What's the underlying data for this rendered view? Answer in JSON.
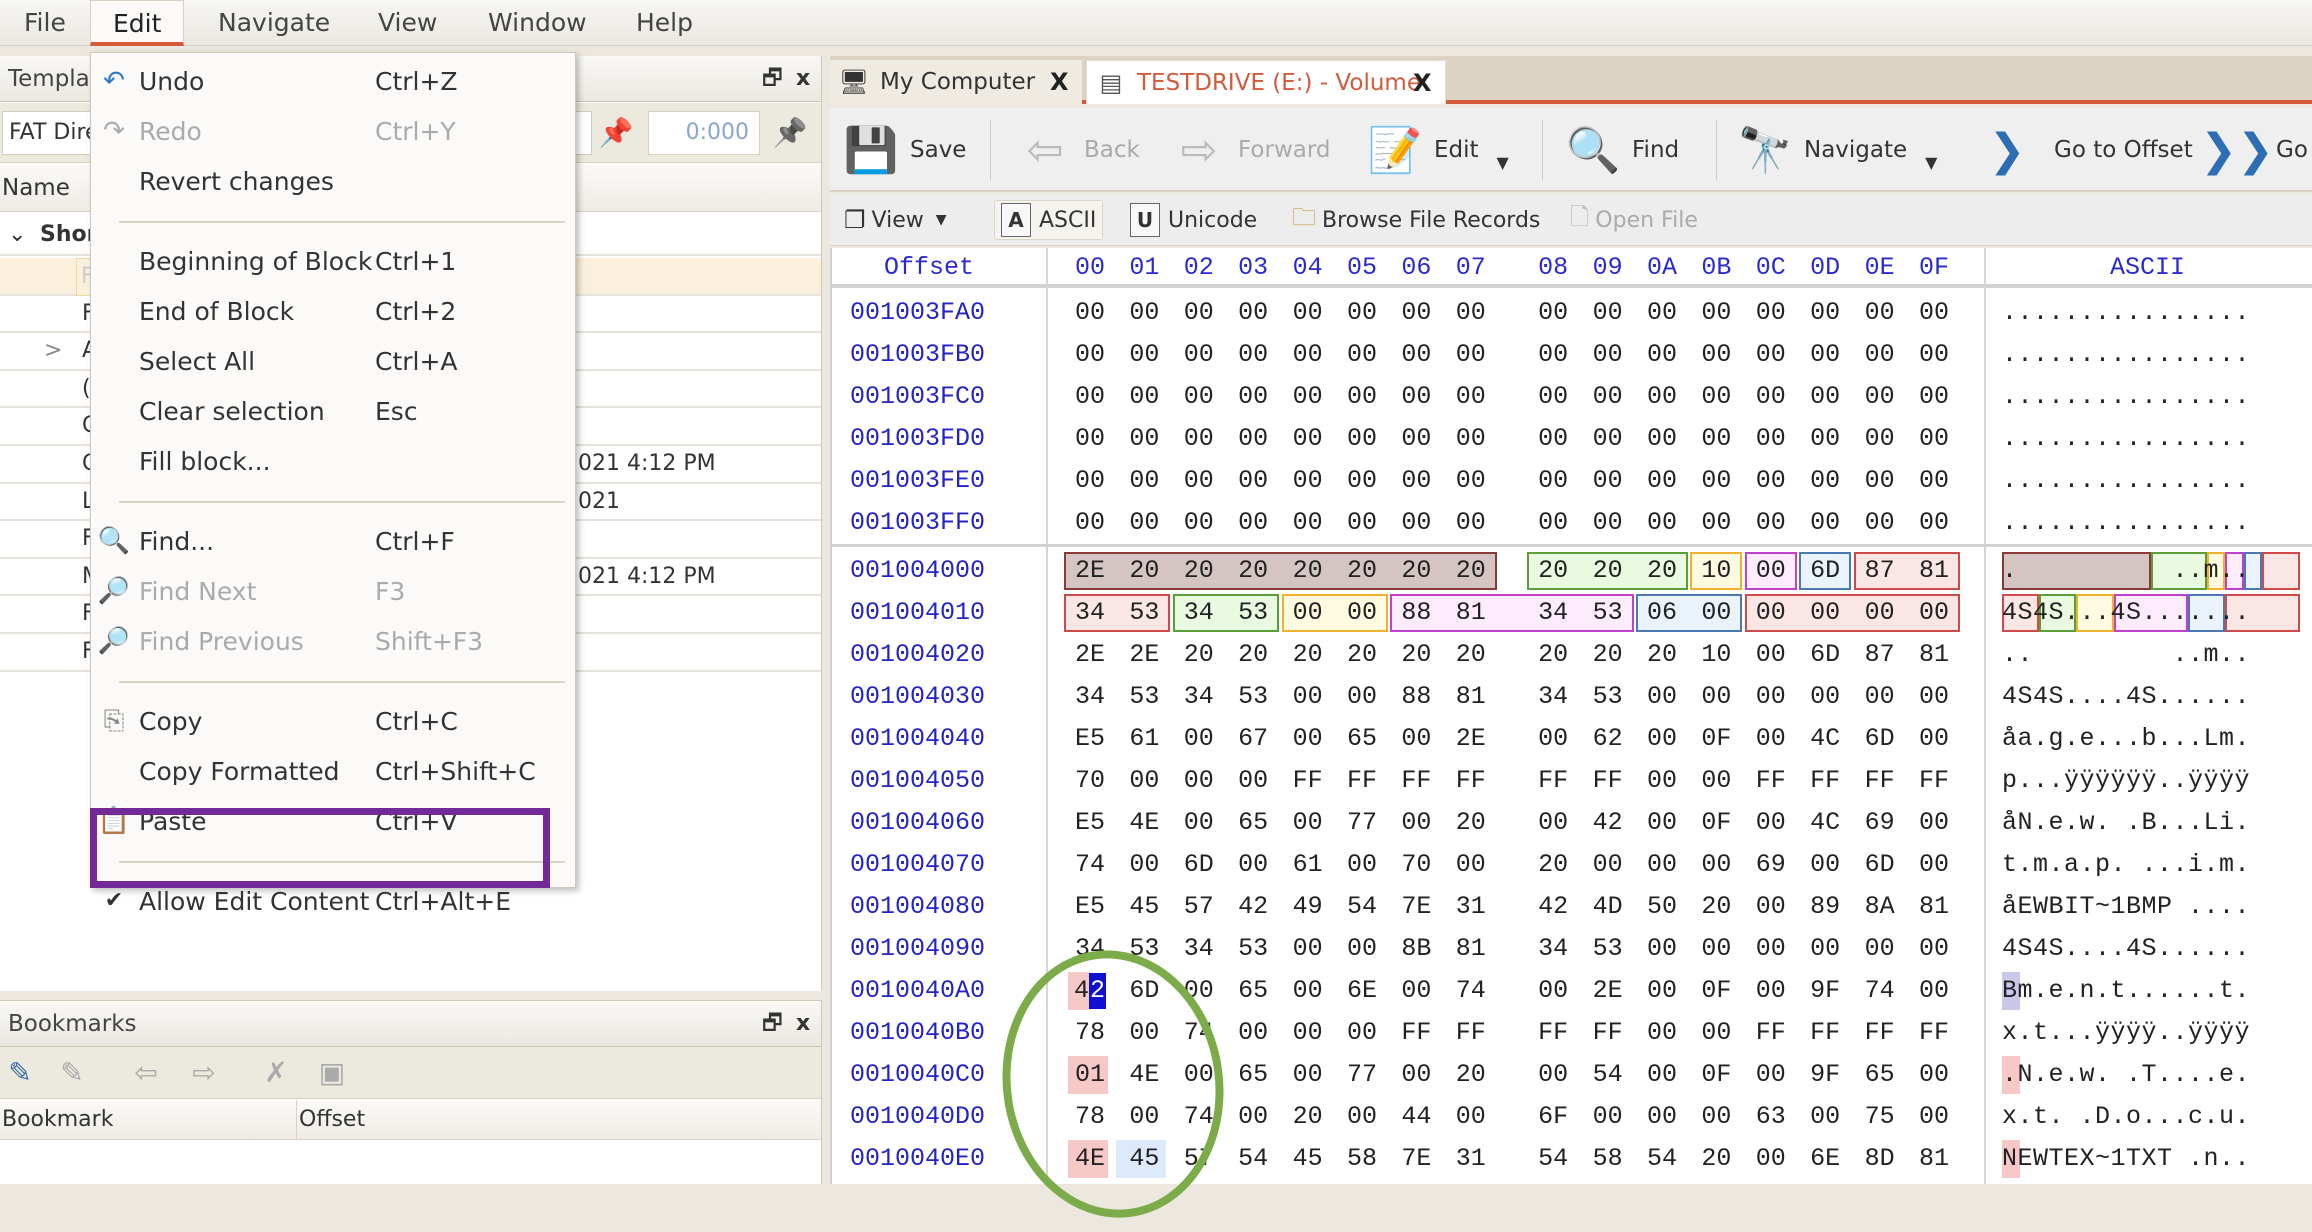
{
  "menubar": {
    "items": [
      "File",
      "Edit",
      "Navigate",
      "View",
      "Window",
      "Help"
    ],
    "active": "Edit"
  },
  "template_panel": {
    "title": "Templat",
    "template_select": "FAT Dire",
    "offset_value": "0:000",
    "column_name": "Name",
    "root_row": "Shor",
    "rows": [
      {
        "lead": "F",
        "tail": "",
        "selected": true
      },
      {
        "lead": "F",
        "tail": ""
      },
      {
        "lead": "A",
        "tail": "",
        "expander": ">"
      },
      {
        "lead": "(",
        "tail": ""
      },
      {
        "lead": "C",
        "tail": ""
      },
      {
        "lead": "C",
        "tail": "021 4:12 PM"
      },
      {
        "lead": "L",
        "tail": "021"
      },
      {
        "lead": "F",
        "tail": ""
      },
      {
        "lead": "M",
        "tail": "021 4:12 PM"
      },
      {
        "lead": "F",
        "tail": ""
      },
      {
        "lead": "F",
        "tail": ""
      }
    ]
  },
  "bookmarks_panel": {
    "title": "Bookmarks",
    "columns": [
      "Bookmark",
      "Offset"
    ]
  },
  "tabs": [
    {
      "label": "My Computer",
      "icon": "computer-icon",
      "active": false,
      "close": "X"
    },
    {
      "label": "TESTDRIVE (E:) - Volume",
      "icon": "volume-icon",
      "active": true,
      "close": "X"
    }
  ],
  "toolbar": {
    "save": "Save",
    "back": "Back",
    "forward": "Forward",
    "edit": "Edit",
    "find": "Find",
    "navigate": "Navigate",
    "go_to_offset": "Go to Offset",
    "go_partial": "Go"
  },
  "toolbar2": {
    "view": "View",
    "ascii": "ASCII",
    "unicode": "Unicode",
    "browse_file_records": "Browse File Records",
    "open_file": "Open File"
  },
  "hex": {
    "header_offset": "Offset",
    "header_cols": [
      "00",
      "01",
      "02",
      "03",
      "04",
      "05",
      "06",
      "07",
      "08",
      "09",
      "0A",
      "0B",
      "0C",
      "0D",
      "0E",
      "0F"
    ],
    "header_ascii": "ASCII",
    "colors": {
      "red_border": "#d04a4a",
      "red_fill": "#fbe6e6",
      "brown_border": "#8b3a3a",
      "brown_fill": "#d5c5c2",
      "green_border": "#5aa03a",
      "green_fill": "#eafae0",
      "yellow_border": "#f0b030",
      "yellow_fill": "#fffbe0",
      "magenta_border": "#c040d0",
      "magenta_fill": "#fcecfc",
      "blue_border": "#4a7ab0",
      "blue_fill": "#eaf2fb",
      "cursor": "#1010d0",
      "pink_mark": "#f6c8c6",
      "lightblue_mark": "#ddeafb"
    },
    "rows": [
      {
        "offset": "001003FA0",
        "bytes": [
          "00",
          "00",
          "00",
          "00",
          "00",
          "00",
          "00",
          "00",
          "00",
          "00",
          "00",
          "00",
          "00",
          "00",
          "00",
          "00"
        ],
        "ascii": "................"
      },
      {
        "offset": "001003FB0",
        "bytes": [
          "00",
          "00",
          "00",
          "00",
          "00",
          "00",
          "00",
          "00",
          "00",
          "00",
          "00",
          "00",
          "00",
          "00",
          "00",
          "00"
        ],
        "ascii": "................"
      },
      {
        "offset": "001003FC0",
        "bytes": [
          "00",
          "00",
          "00",
          "00",
          "00",
          "00",
          "00",
          "00",
          "00",
          "00",
          "00",
          "00",
          "00",
          "00",
          "00",
          "00"
        ],
        "ascii": "................"
      },
      {
        "offset": "001003FD0",
        "bytes": [
          "00",
          "00",
          "00",
          "00",
          "00",
          "00",
          "00",
          "00",
          "00",
          "00",
          "00",
          "00",
          "00",
          "00",
          "00",
          "00"
        ],
        "ascii": "................"
      },
      {
        "offset": "001003FE0",
        "bytes": [
          "00",
          "00",
          "00",
          "00",
          "00",
          "00",
          "00",
          "00",
          "00",
          "00",
          "00",
          "00",
          "00",
          "00",
          "00",
          "00"
        ],
        "ascii": "................"
      },
      {
        "offset": "001003FF0",
        "bytes": [
          "00",
          "00",
          "00",
          "00",
          "00",
          "00",
          "00",
          "00",
          "00",
          "00",
          "00",
          "00",
          "00",
          "00",
          "00",
          "00"
        ],
        "ascii": "................"
      },
      {
        "offset": "001004000",
        "bytes": [
          "2E",
          "20",
          "20",
          "20",
          "20",
          "20",
          "20",
          "20",
          "20",
          "20",
          "20",
          "10",
          "00",
          "6D",
          "87",
          "81"
        ],
        "ascii": ".          ..m..",
        "groups": [
          [
            0,
            7,
            "brown"
          ],
          [
            8,
            10,
            "green"
          ],
          [
            11,
            11,
            "yellow"
          ],
          [
            12,
            12,
            "magenta"
          ],
          [
            13,
            13,
            "blue"
          ],
          [
            14,
            15,
            "red"
          ]
        ]
      },
      {
        "offset": "001004010",
        "bytes": [
          "34",
          "53",
          "34",
          "53",
          "00",
          "00",
          "88",
          "81",
          "34",
          "53",
          "06",
          "00",
          "00",
          "00",
          "00",
          "00"
        ],
        "ascii": "4S4S...4S.......",
        "groups": [
          [
            0,
            1,
            "red"
          ],
          [
            2,
            3,
            "green"
          ],
          [
            4,
            5,
            "yellow"
          ],
          [
            6,
            9,
            "magenta"
          ],
          [
            10,
            11,
            "blue"
          ],
          [
            12,
            15,
            "red"
          ]
        ]
      },
      {
        "offset": "001004020",
        "bytes": [
          "2E",
          "2E",
          "20",
          "20",
          "20",
          "20",
          "20",
          "20",
          "20",
          "20",
          "20",
          "10",
          "00",
          "6D",
          "87",
          "81"
        ],
        "ascii": "..         ..m.."
      },
      {
        "offset": "001004030",
        "bytes": [
          "34",
          "53",
          "34",
          "53",
          "00",
          "00",
          "88",
          "81",
          "34",
          "53",
          "00",
          "00",
          "00",
          "00",
          "00",
          "00"
        ],
        "ascii": "4S4S....4S......"
      },
      {
        "offset": "001004040",
        "bytes": [
          "E5",
          "61",
          "00",
          "67",
          "00",
          "65",
          "00",
          "2E",
          "00",
          "62",
          "00",
          "0F",
          "00",
          "4C",
          "6D",
          "00"
        ],
        "ascii": "åa.g.e...b...Lm."
      },
      {
        "offset": "001004050",
        "bytes": [
          "70",
          "00",
          "00",
          "00",
          "FF",
          "FF",
          "FF",
          "FF",
          "FF",
          "FF",
          "00",
          "00",
          "FF",
          "FF",
          "FF",
          "FF"
        ],
        "ascii": "p...ÿÿÿÿÿÿ..ÿÿÿÿ"
      },
      {
        "offset": "001004060",
        "bytes": [
          "E5",
          "4E",
          "00",
          "65",
          "00",
          "77",
          "00",
          "20",
          "00",
          "42",
          "00",
          "0F",
          "00",
          "4C",
          "69",
          "00"
        ],
        "ascii": "åN.e.w. .B...Li."
      },
      {
        "offset": "001004070",
        "bytes": [
          "74",
          "00",
          "6D",
          "00",
          "61",
          "00",
          "70",
          "00",
          "20",
          "00",
          "00",
          "00",
          "69",
          "00",
          "6D",
          "00"
        ],
        "ascii": "t.m.a.p. ...i.m."
      },
      {
        "offset": "001004080",
        "bytes": [
          "E5",
          "45",
          "57",
          "42",
          "49",
          "54",
          "7E",
          "31",
          "42",
          "4D",
          "50",
          "20",
          "00",
          "89",
          "8A",
          "81"
        ],
        "ascii": "åEWBIT~1BMP ...."
      },
      {
        "offset": "001004090",
        "bytes": [
          "34",
          "53",
          "34",
          "53",
          "00",
          "00",
          "8B",
          "81",
          "34",
          "53",
          "00",
          "00",
          "00",
          "00",
          "00",
          "00"
        ],
        "ascii": "4S4S....4S......"
      },
      {
        "offset": "0010040A0",
        "bytes": [
          "42",
          "6D",
          "00",
          "65",
          "00",
          "6E",
          "00",
          "74",
          "00",
          "2E",
          "00",
          "0F",
          "00",
          "9F",
          "74",
          "00"
        ],
        "ascii": "Bm.e.n.t......t.",
        "mark0": "pink",
        "cursor": 0,
        "ascii_mark": "lavender"
      },
      {
        "offset": "0010040B0",
        "bytes": [
          "78",
          "00",
          "74",
          "00",
          "00",
          "00",
          "FF",
          "FF",
          "FF",
          "FF",
          "00",
          "00",
          "FF",
          "FF",
          "FF",
          "FF"
        ],
        "ascii": "x.t...ÿÿÿÿ..ÿÿÿÿ"
      },
      {
        "offset": "0010040C0",
        "bytes": [
          "01",
          "4E",
          "00",
          "65",
          "00",
          "77",
          "00",
          "20",
          "00",
          "54",
          "00",
          "0F",
          "00",
          "9F",
          "65",
          "00"
        ],
        "ascii": ".N.e.w. .T....e.",
        "mark0": "pink",
        "ascii_mark": "pink"
      },
      {
        "offset": "0010040D0",
        "bytes": [
          "78",
          "00",
          "74",
          "00",
          "20",
          "00",
          "44",
          "00",
          "6F",
          "00",
          "00",
          "00",
          "63",
          "00",
          "75",
          "00"
        ],
        "ascii": "x.t. .D.o...c.u."
      },
      {
        "offset": "0010040E0",
        "bytes": [
          "4E",
          "45",
          "57",
          "54",
          "45",
          "58",
          "7E",
          "31",
          "54",
          "58",
          "54",
          "20",
          "00",
          "6E",
          "8D",
          "81"
        ],
        "ascii": "NEWTEX~1TXT .n..",
        "mark0": "pink",
        "mark1": "lightblue",
        "ascii_mark": "pink"
      }
    ]
  },
  "edit_menu": {
    "items": [
      {
        "label": "Undo",
        "shortcut": "Ctrl+Z",
        "icon": "undo-icon",
        "enabled": true
      },
      {
        "label": "Redo",
        "shortcut": "Ctrl+Y",
        "icon": "redo-icon",
        "enabled": false
      },
      {
        "label": "Revert changes",
        "shortcut": "",
        "enabled": true
      },
      {
        "sep": true
      },
      {
        "label": "Beginning of Block",
        "shortcut": "Ctrl+1",
        "enabled": true
      },
      {
        "label": "End of Block",
        "shortcut": "Ctrl+2",
        "enabled": true
      },
      {
        "label": "Select All",
        "shortcut": "Ctrl+A",
        "enabled": true
      },
      {
        "label": "Clear selection",
        "shortcut": "Esc",
        "enabled": true
      },
      {
        "label": "Fill block...",
        "shortcut": "",
        "enabled": true
      },
      {
        "sep": true
      },
      {
        "label": "Find...",
        "shortcut": "Ctrl+F",
        "icon": "find-icon",
        "enabled": true
      },
      {
        "label": "Find Next",
        "shortcut": "F3",
        "icon": "find-next-icon",
        "enabled": false
      },
      {
        "label": "Find Previous",
        "shortcut": "Shift+F3",
        "icon": "find-previous-icon",
        "enabled": false
      },
      {
        "sep": true
      },
      {
        "label": "Copy",
        "shortcut": "Ctrl+C",
        "icon": "copy-icon",
        "enabled": true
      },
      {
        "label": "Copy Formatted",
        "shortcut": "Ctrl+Shift+C",
        "enabled": true
      },
      {
        "label": "Paste",
        "shortcut": "Ctrl+V",
        "icon": "paste-icon",
        "enabled": true
      },
      {
        "sep": true
      },
      {
        "label": "Allow Edit Content",
        "shortcut": "Ctrl+Alt+E",
        "checked": true,
        "enabled": true
      }
    ],
    "highlight_color": "#732a96"
  },
  "annotation": {
    "circle_color": "#7cac4a"
  }
}
